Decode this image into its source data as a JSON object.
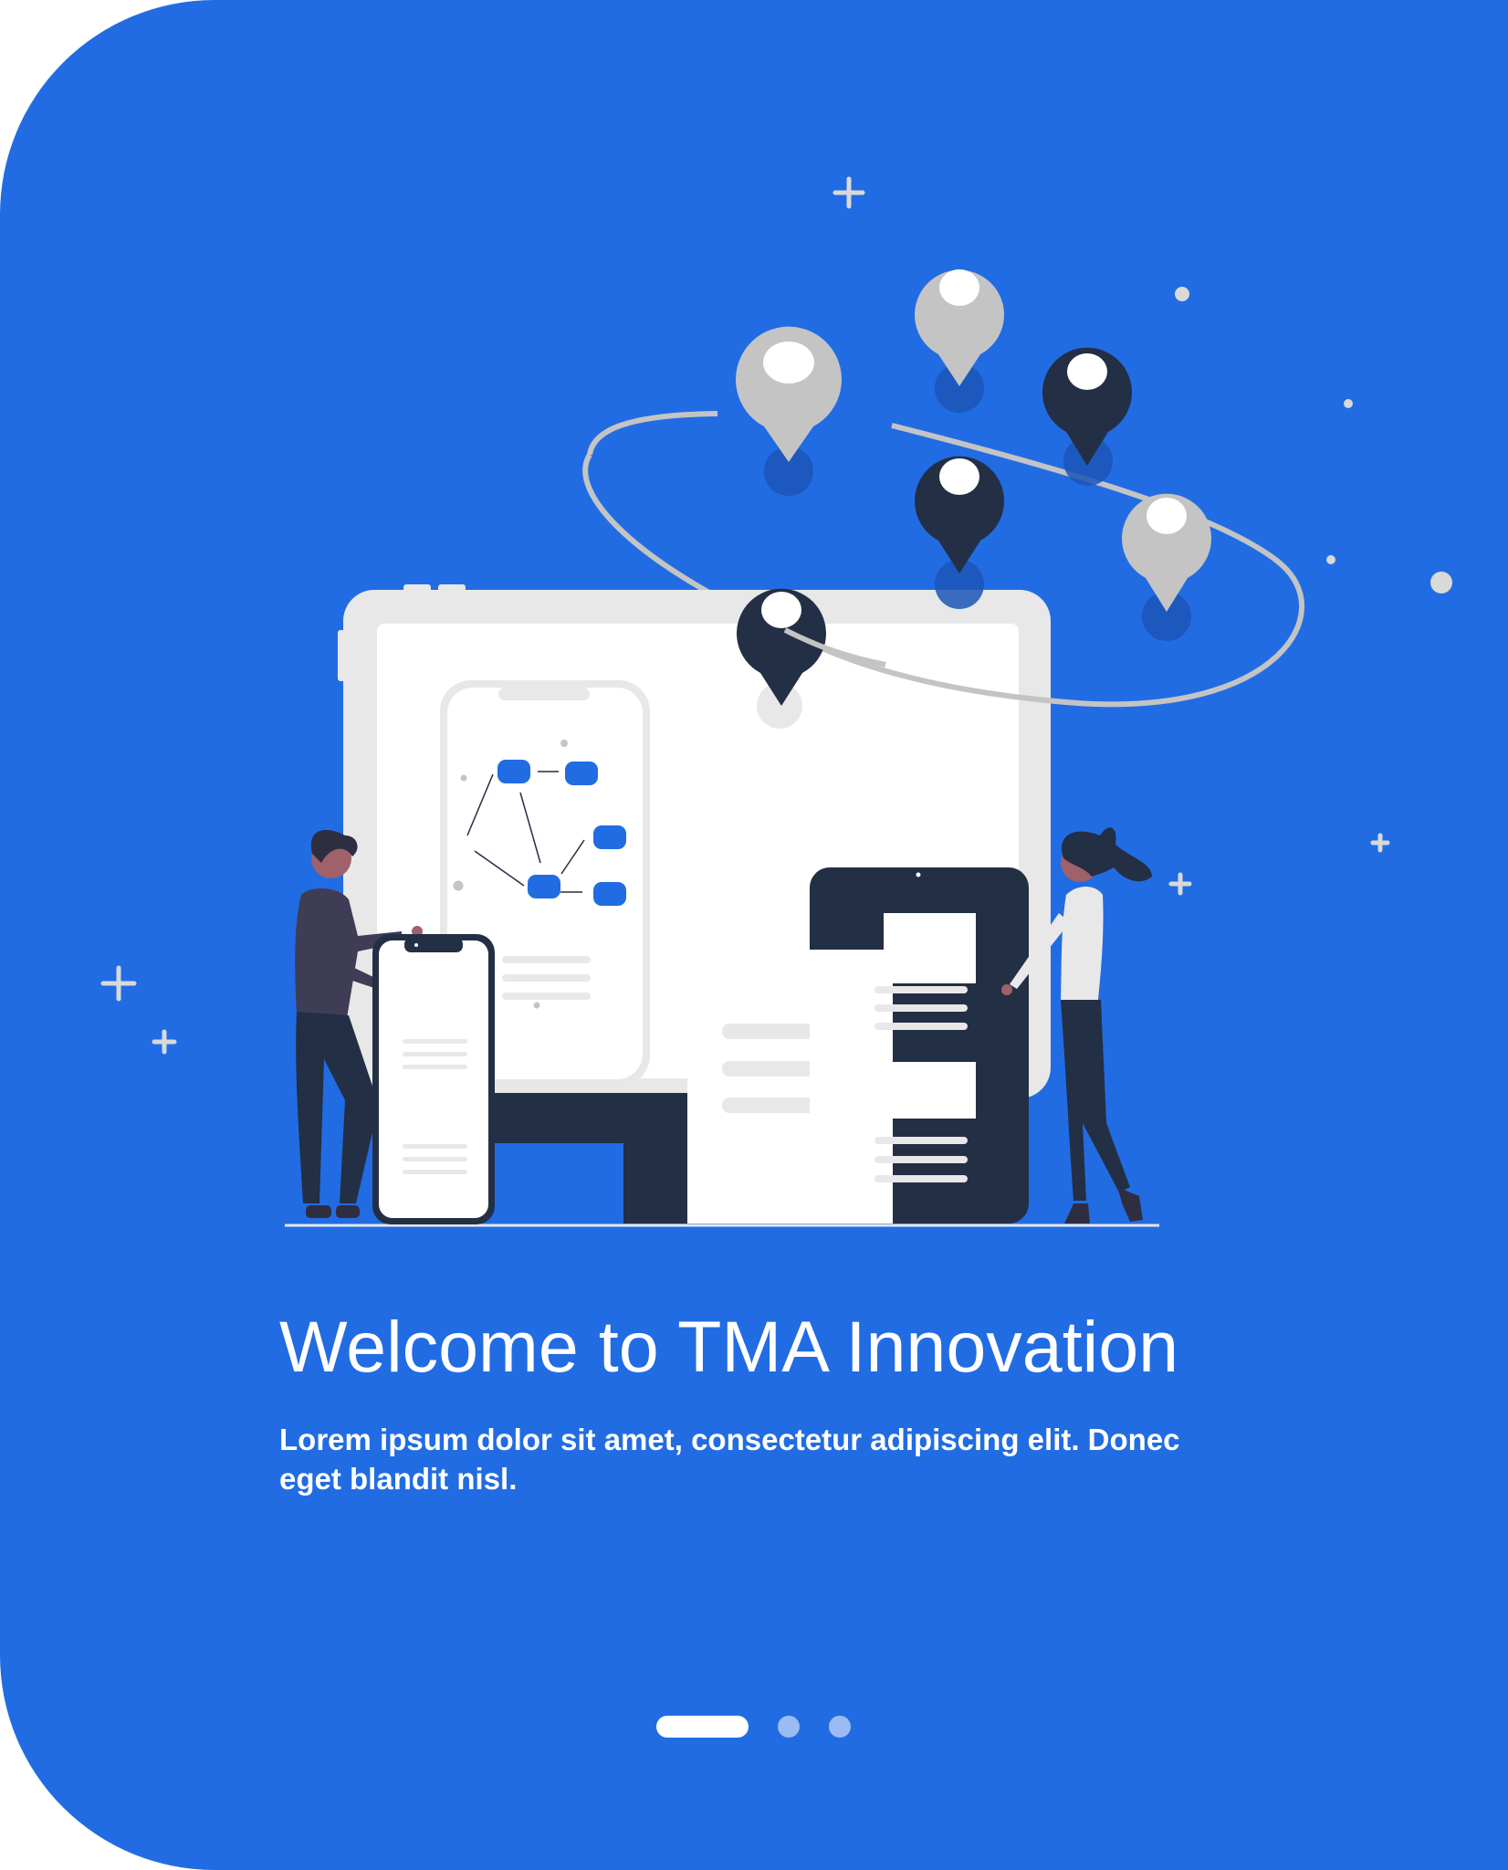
{
  "onboarding": {
    "title": "Welcome to TMA Innovation",
    "subtitle": "Lorem ipsum dolor sit amet, consectetur adipiscing elit. Donec eget blandit nisl.",
    "pager": {
      "total": 3,
      "current": 1
    },
    "illustration": {
      "icon": "location-devices-illustration"
    }
  },
  "colors": {
    "background": "#216ce3",
    "white": "#ffffff",
    "navy": "#232f44",
    "light_gray": "#e8e8e8",
    "pin_gray": "#c4c4c4",
    "accent_blue": "#216ce3"
  }
}
